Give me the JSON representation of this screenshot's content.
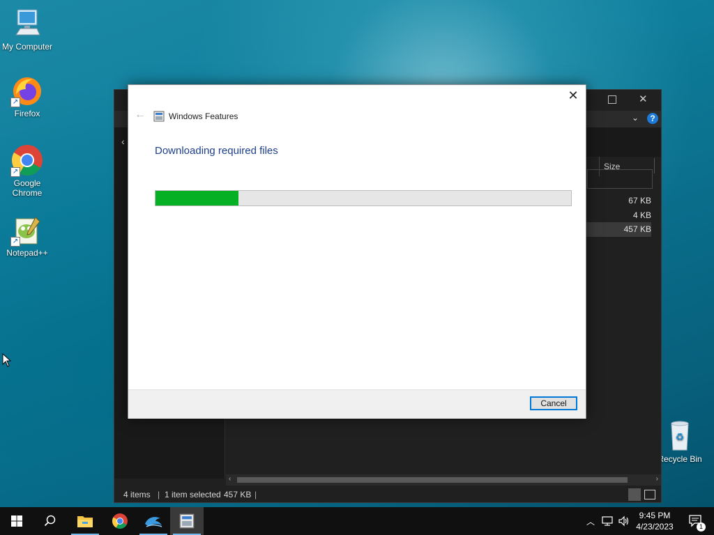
{
  "desktop": {
    "icons": [
      {
        "label": "My Computer"
      },
      {
        "label": "Firefox"
      },
      {
        "label": "Google Chrome"
      },
      {
        "label": "Notepad++"
      },
      {
        "label": "Recycle Bin"
      }
    ]
  },
  "explorer": {
    "column_size": "Size",
    "sizes": [
      "67 KB",
      "4 KB",
      "457 KB"
    ],
    "status": {
      "items": "4 items",
      "selected": "1 item selected",
      "selected_size": "457 KB"
    }
  },
  "dialog": {
    "title": "Windows Features",
    "heading": "Downloading required files",
    "progress_fraction": 0.2,
    "cancel_label": "Cancel",
    "close_glyph": "✕",
    "back_glyph": "←"
  },
  "taskbar": {
    "items": [
      "start-icon",
      "search-icon",
      "file-explorer-icon",
      "chrome-icon",
      "dolphin-icon",
      "windows-features-icon"
    ],
    "clock": {
      "time": "9:45 PM",
      "date": "4/23/2023"
    },
    "notification_count": "1"
  },
  "colors": {
    "progress_fill": "#06b025",
    "accent": "#0078d7",
    "heading": "#1e3f8a"
  }
}
